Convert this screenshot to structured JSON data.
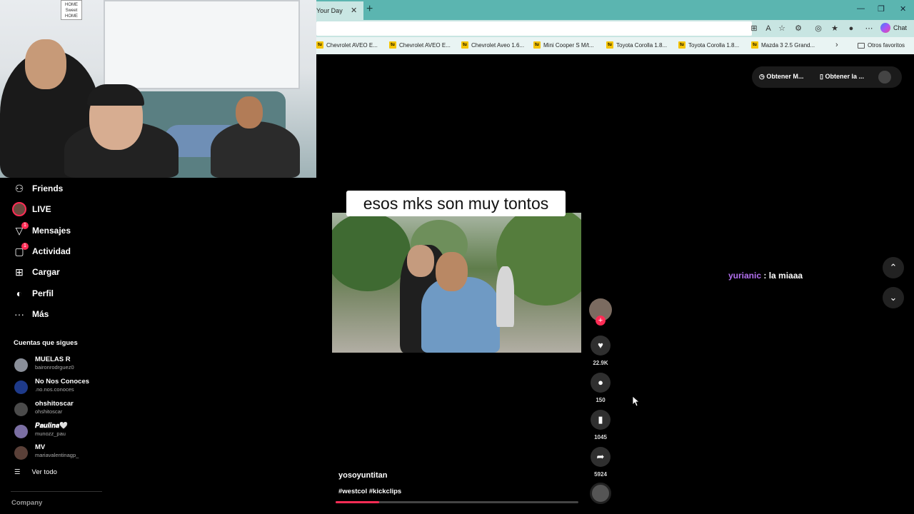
{
  "browser": {
    "tab_title": "Your Day",
    "tab_close": "✕",
    "new_tab": "+",
    "window_controls": [
      "—",
      "❐",
      "✕"
    ],
    "chat_label": "Chat",
    "bookmarks": [
      "Chevrolet AVEO E...",
      "Chevrolet AVEO E...",
      "Chevrolet Aveo 1.6...",
      "Mini Cooper S M/t...",
      "Toyota Corolla 1.8...",
      "Toyota Corolla 1.8...",
      "Mazda 3 2.5 Grand..."
    ],
    "bookmark_favicon": "tu",
    "other_bookmarks": "Otros favoritos",
    "more_icon": "›"
  },
  "webcam": {
    "sign_text": "HOME Sweet HOME"
  },
  "sidebar": {
    "items": [
      {
        "label": "Friends",
        "icon": "people-icon",
        "glyph": "⚇"
      },
      {
        "label": "LIVE",
        "icon": "live-icon",
        "glyph": ""
      },
      {
        "label": "Mensajes",
        "icon": "messages-icon",
        "glyph": "▽",
        "badge": "1"
      },
      {
        "label": "Actividad",
        "icon": "activity-icon",
        "glyph": "▢",
        "badge": "1"
      },
      {
        "label": "Cargar",
        "icon": "upload-icon",
        "glyph": "⊞"
      },
      {
        "label": "Perfil",
        "icon": "profile-icon",
        "glyph": "◐"
      },
      {
        "label": "Más",
        "icon": "more-icon",
        "glyph": "···"
      }
    ],
    "following_title": "Cuentas que sigues",
    "accounts": [
      {
        "name": "MUELAS R",
        "handle": "baironrodrguez0"
      },
      {
        "name": "No Nos Conoces",
        "handle": ".no.nos.conoces"
      },
      {
        "name": "ohshitoscar",
        "handle": "ohshitoscar"
      },
      {
        "name": "𝑷𝒂𝒖𝒍𝒊𝒏𝒂🤍",
        "handle": "munozz_pau"
      },
      {
        "name": "MV",
        "handle": "mariavalentinagp_"
      }
    ],
    "see_all": "Ver todo",
    "see_all_icon": "☰",
    "company": "Company"
  },
  "video": {
    "caption": "esos mks son muy tontos",
    "author": "yosoyuntitan",
    "tags": "#westcol #kickclips",
    "progress": 0.18
  },
  "actions": {
    "follow": "+",
    "like_icon": "♥",
    "like_count": "22.9K",
    "comment_icon": "●",
    "comment_count": "150",
    "save_icon": "▮",
    "save_count": "1045",
    "share_icon": "➦",
    "share_count": "5924"
  },
  "top_bar": {
    "item1": "Obtener M...",
    "item2": "Obtener la ..."
  },
  "chat": {
    "user": "yurianic",
    "text": " : la miaaa"
  },
  "scroll": {
    "up": "⌃",
    "down": "⌄"
  },
  "colors": {
    "accent": "#fe2c55",
    "chat_user": "#b370f0",
    "tab_bar": "#5bb5b0"
  }
}
